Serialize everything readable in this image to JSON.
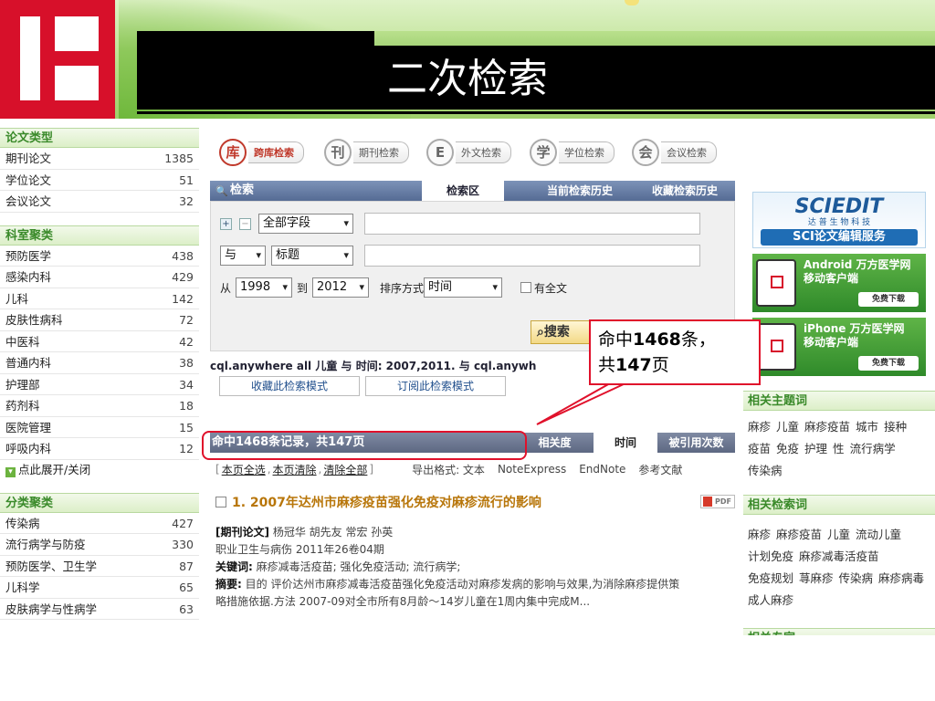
{
  "slide": {
    "title": "二次检索"
  },
  "left_sidebar": {
    "sections": [
      {
        "heading": "论文类型",
        "items": [
          {
            "label": "期刊论文",
            "count": "1385"
          },
          {
            "label": "学位论文",
            "count": "51"
          },
          {
            "label": "会议论文",
            "count": "32"
          }
        ]
      },
      {
        "heading": "科室聚类",
        "items": [
          {
            "label": "预防医学",
            "count": "438"
          },
          {
            "label": "感染内科",
            "count": "429"
          },
          {
            "label": "儿科",
            "count": "142"
          },
          {
            "label": "皮肤性病科",
            "count": "72"
          },
          {
            "label": "中医科",
            "count": "42"
          },
          {
            "label": "普通内科",
            "count": "38"
          },
          {
            "label": "护理部",
            "count": "34"
          },
          {
            "label": "药剂科",
            "count": "18"
          },
          {
            "label": "医院管理",
            "count": "15"
          },
          {
            "label": "呼吸内科",
            "count": "12"
          }
        ],
        "toggle": "点此展开/关闭"
      },
      {
        "heading": "分类聚类",
        "items": [
          {
            "label": "传染病",
            "count": "427"
          },
          {
            "label": "流行病学与防疫",
            "count": "330"
          },
          {
            "label": "预防医学、卫生学",
            "count": "87"
          },
          {
            "label": "儿科学",
            "count": "65"
          },
          {
            "label": "皮肤病学与性病学",
            "count": "63"
          }
        ]
      }
    ]
  },
  "db_tabs": [
    {
      "badge": "库",
      "label": "跨库检索",
      "active": true
    },
    {
      "badge": "刊",
      "label": "期刊检索"
    },
    {
      "badge": "E",
      "label": "外文检索"
    },
    {
      "badge": "学",
      "label": "学位检索"
    },
    {
      "badge": "会",
      "label": "会议检索"
    }
  ],
  "search_panel": {
    "title": "检索",
    "tabs": [
      "检索区",
      "当前检索历史",
      "收藏检索历史"
    ],
    "row1": {
      "field": "全部字段",
      "value": ""
    },
    "row2": {
      "logic": "与",
      "field": "标题",
      "value": ""
    },
    "row3": {
      "from_label": "从",
      "from_year": "1998",
      "to_label": "到",
      "to_year": "2012",
      "sort_label": "排序方式",
      "sort_value": "时间",
      "fulltext_label": "有全文"
    },
    "search_button": "搜索",
    "query_text": "cql.anywhere all 儿童 与 时间: 2007,2011. 与 cql.anywh",
    "save_mode": "收藏此检索模式",
    "subscribe_mode": "订阅此检索模式"
  },
  "results": {
    "summary": "命中1468条记录，共147页",
    "sort_tabs": [
      "相关度",
      "时间",
      "被引用次数"
    ],
    "actions": {
      "select_page": "本页全选",
      "clear_page": "本页清除",
      "clear_all": "清除全部",
      "export_label": "导出格式: 文本",
      "note_express": "NoteExpress",
      "endnote": "EndNote",
      "reference": "参考文献"
    },
    "article": {
      "title": "1. 2007年达州市麻疹疫苗强化免疫对麻疹流行的影响",
      "pdf": "PDF",
      "type": "[期刊论文]",
      "authors": "杨冠华 胡先友 常宏 孙英",
      "journal": "职业卫生与病伤 2011年26卷04期",
      "keywords_label": "关键词:",
      "keywords": "麻疹减毒活疫苗; 强化免疫活动; 流行病学;",
      "abstract_label": "摘要:",
      "abstract_1": "目的  评价达州市麻疹减毒活疫苗强化免疫活动对麻疹发病的影响与效果,为消除麻疹提供策",
      "abstract_2": "略措施依据.方法  2007-09对全市所有8月龄～14岁儿童在1周内集中完成M..."
    }
  },
  "right_sidebar": {
    "ad_sciedit": {
      "brand": "SCIEDIT",
      "sub": "达 普 生 物 科 技",
      "service": "SCI论文编辑服务"
    },
    "ad_android": {
      "line1": "Android 万方医学网",
      "line2": "移动客户端",
      "download": "免费下载"
    },
    "ad_iphone": {
      "line1": "iPhone 万方医学网",
      "line2": "移动客户端",
      "download": "免费下载"
    },
    "related_topics_heading": "相关主题词",
    "related_topics": [
      "麻疹",
      "儿童",
      "麻疹疫苗",
      "城市",
      "接种",
      "疫苗",
      "免疫",
      "护理",
      "性",
      "流行病学",
      "传染病"
    ],
    "related_terms_heading": "相关检索词",
    "related_terms": [
      "麻疹",
      "麻疹疫苗",
      "儿童",
      "流动儿童",
      "计划免疫",
      "麻疹减毒活疫苗",
      "免疫规划",
      "荨麻疹",
      "传染病",
      "麻疹病毒",
      "成人麻疹"
    ],
    "experts_heading": "相关专家"
  },
  "callout": {
    "line1_a": "命中",
    "line1_b": "1468",
    "line1_c": "条，",
    "line2_a": "共",
    "line2_b": "147",
    "line2_c": "页"
  },
  "colors": {
    "accent_red": "#e0112b",
    "brand_green": "#3a8a2a",
    "logo_red": "#d7102a"
  }
}
